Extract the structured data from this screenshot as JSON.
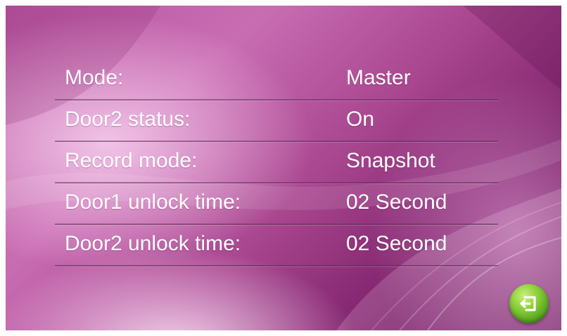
{
  "settings": {
    "rows": [
      {
        "label": "Mode:",
        "value": "Master"
      },
      {
        "label": "Door2 status:",
        "value": "On"
      },
      {
        "label": "Record mode:",
        "value": "Snapshot"
      },
      {
        "label": "Door1 unlock time:",
        "value": "02 Second"
      },
      {
        "label": "Door2 unlock time:",
        "value": "02 Second"
      }
    ]
  },
  "back_button": {
    "icon": "return-arrow-icon",
    "color": "#6fbf2a"
  },
  "theme": {
    "accent": "#b14f99",
    "text_color": "#ffffff"
  }
}
